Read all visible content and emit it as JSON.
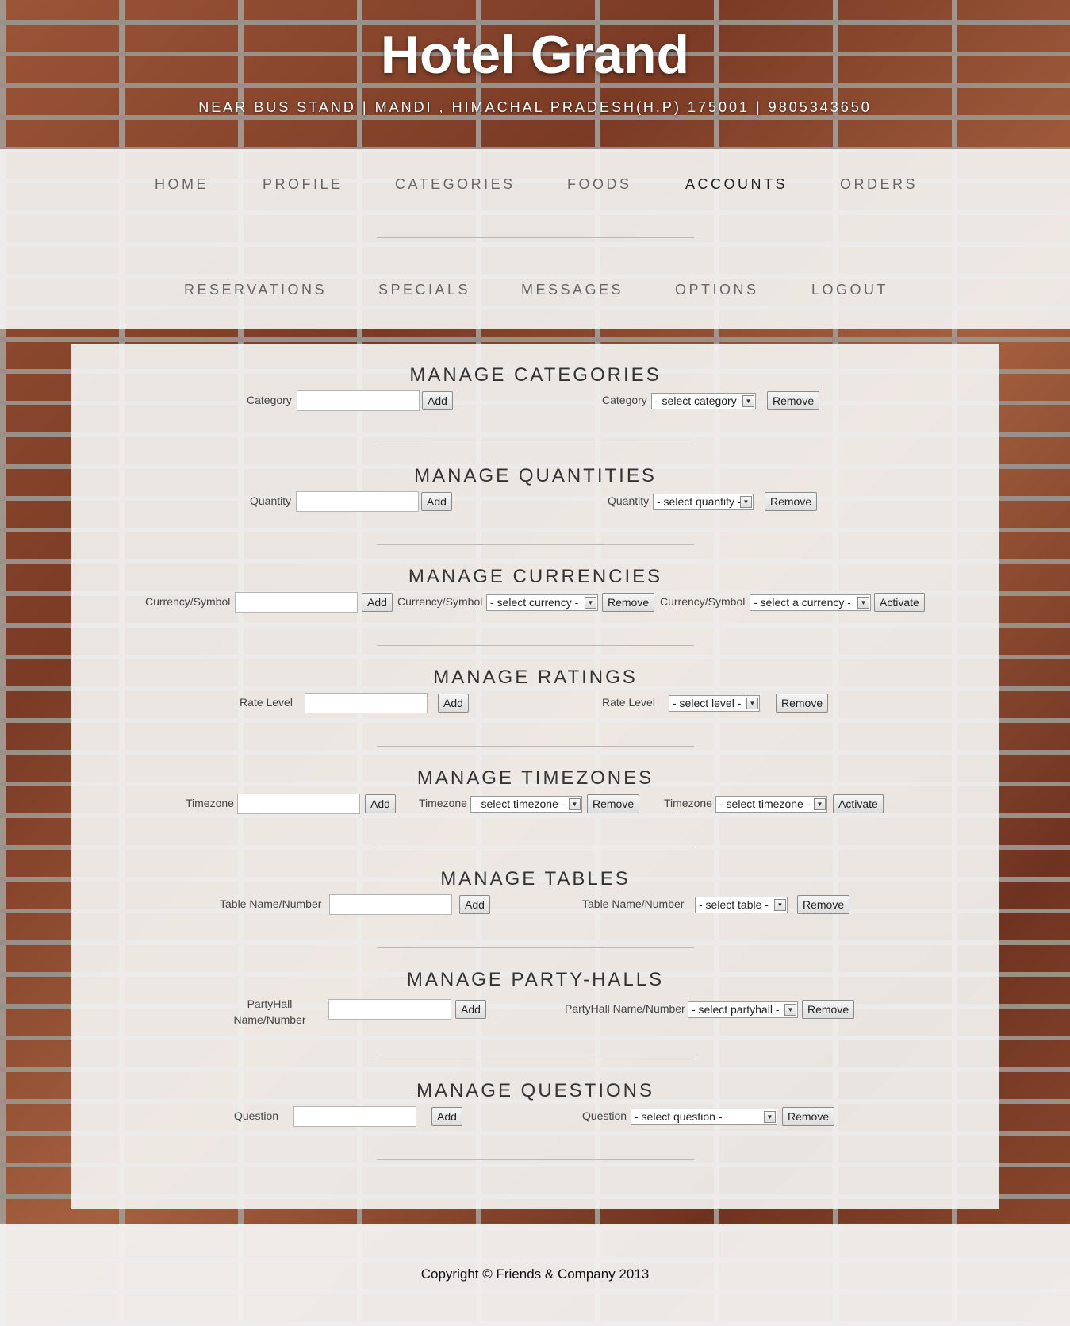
{
  "header": {
    "title": "Hotel Grand",
    "address": "NEAR BUS STAND | MANDI , HIMACHAL PRADESH(H.P) 175001 | 9805343650"
  },
  "nav": {
    "row1": [
      "HOME",
      "PROFILE",
      "CATEGORIES",
      "FOODS",
      "ACCOUNTS",
      "ORDERS"
    ],
    "row2": [
      "RESERVATIONS",
      "SPECIALS",
      "MESSAGES",
      "OPTIONS",
      "LOGOUT"
    ],
    "active": "ACCOUNTS"
  },
  "buttons": {
    "add": "Add",
    "remove": "Remove",
    "activate": "Activate",
    "arrow": "▼"
  },
  "sections": {
    "categories": {
      "title": "MANAGE CATEGORIES",
      "add_label": "Category",
      "remove_label": "Category",
      "select": "- select category -"
    },
    "quantities": {
      "title": "MANAGE QUANTITIES",
      "add_label": "Quantity",
      "remove_label": "Quantity",
      "select": "- select quantity -"
    },
    "currencies": {
      "title": "MANAGE CURRENCIES",
      "add_label": "Currency/Symbol",
      "remove_label": "Currency/Symbol",
      "select": "- select currency -",
      "activate_label": "Currency/Symbol",
      "activate_select": "- select a currency -"
    },
    "ratings": {
      "title": "MANAGE RATINGS",
      "add_label": "Rate Level",
      "remove_label": "Rate Level",
      "select": "- select level -"
    },
    "timezones": {
      "title": "MANAGE TIMEZONES",
      "add_label": "Timezone",
      "remove_label": "Timezone",
      "select": "- select timezone -",
      "activate_label": "Timezone",
      "activate_select": "- select timezone -"
    },
    "tables": {
      "title": "MANAGE TABLES",
      "add_label": "Table Name/Number",
      "remove_label": "Table Name/Number",
      "select": "- select table -"
    },
    "partyhalls": {
      "title": "MANAGE PARTY-HALLS",
      "add_label": "PartyHall Name/Number",
      "remove_label": "PartyHall Name/Number",
      "select": "- select partyhall -"
    },
    "questions": {
      "title": "MANAGE QUESTIONS",
      "add_label": "Question",
      "remove_label": "Question",
      "select": "- select question -"
    }
  },
  "footer": {
    "copyright": "Copyright © Friends & Company 2013"
  }
}
